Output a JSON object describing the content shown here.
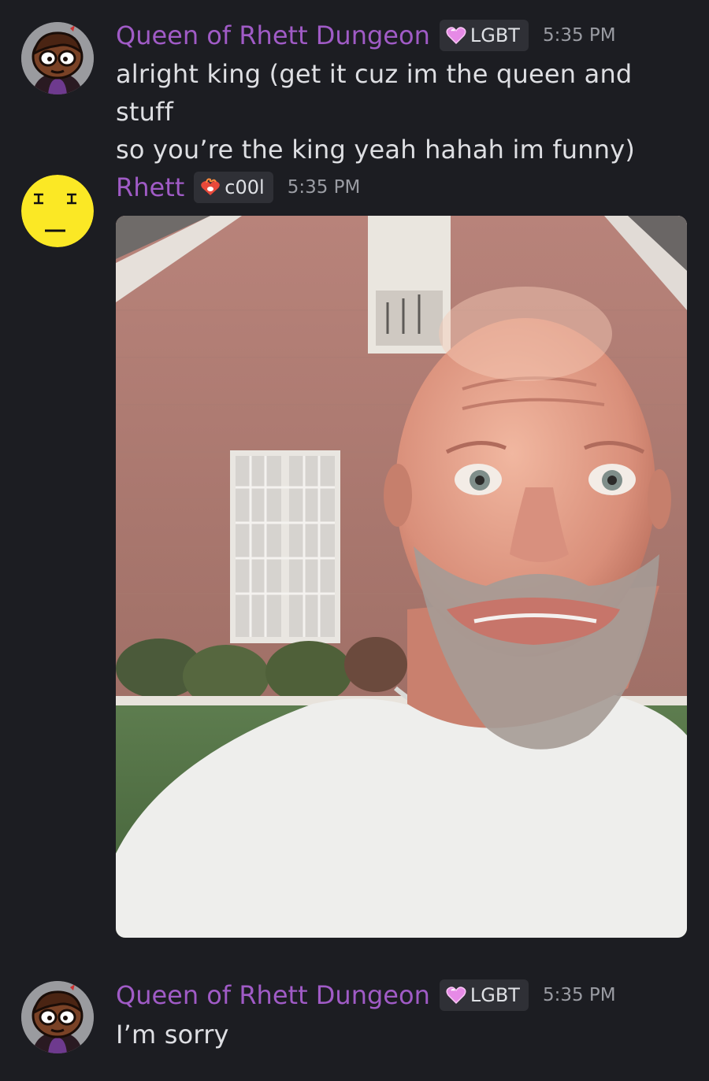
{
  "messages": [
    {
      "author": "Queen of Rhett Dungeon",
      "role_tag": "LGBT",
      "timestamp": "5:35 PM",
      "lines": [
        "alright king (get it cuz im the queen and stuff",
        "so you’re the king yeah hahah im funny)"
      ]
    },
    {
      "author": "Rhett",
      "role_tag": "c00l",
      "timestamp": "5:35 PM",
      "attachment": "gif-video"
    },
    {
      "author": "Queen of Rhett Dungeon",
      "role_tag": "LGBT",
      "timestamp": "5:35 PM",
      "lines": [
        "I’m sorry"
      ]
    }
  ],
  "colors": {
    "background": "#1c1d22",
    "username": "#a05bc6",
    "message_text": "#dedfe3",
    "timestamp": "#9a9ca3",
    "tag_background": "#2f3036"
  },
  "icons": {
    "lgbt_tag": "pink-heart-icon",
    "cool_tag": "fire-heart-icon"
  }
}
